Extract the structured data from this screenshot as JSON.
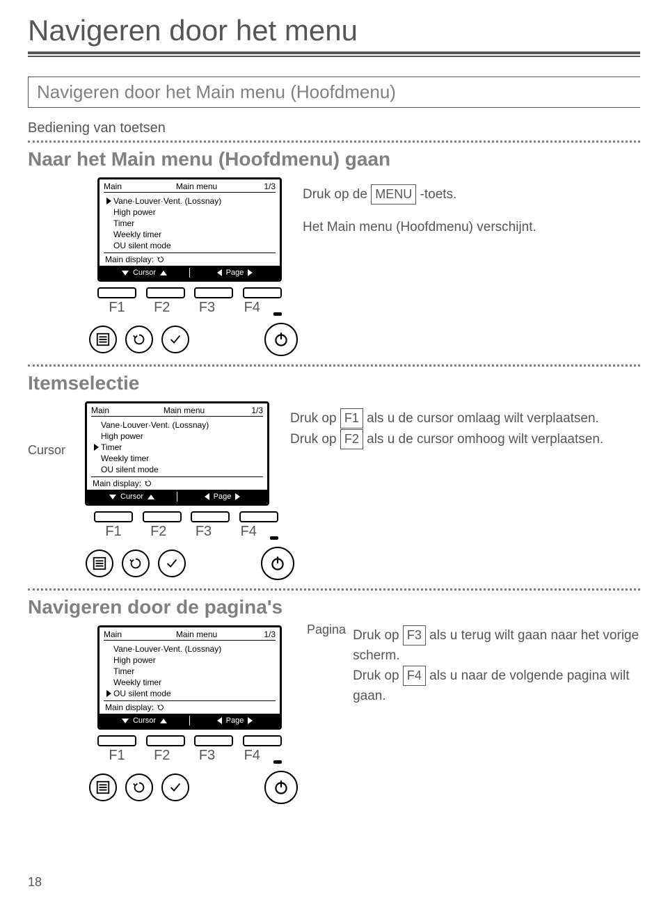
{
  "page": {
    "title": "Navigeren door het menu",
    "section_head": "Navigeren door het Main menu (Hoofdmenu)",
    "subhead": "Bediening van toetsen",
    "page_number": "18"
  },
  "s1": {
    "heading": "Naar het Main menu (Hoofdmenu) gaan",
    "instr_l1a": "Druk op de ",
    "instr_l1_btn": "MENU",
    "instr_l1b": " -toets.",
    "instr_l2": "Het Main menu (Hoofdmenu) verschijnt."
  },
  "s2": {
    "heading": "Itemselectie",
    "cursor_label": "Cursor",
    "instr_a1": "Druk op ",
    "instr_a_btn": "F1",
    "instr_a2": " als u de cursor omlaag wilt verplaatsen.",
    "instr_b1": "Druk op ",
    "instr_b_btn": "F2",
    "instr_b2": " als u de cursor omhoog wilt verplaatsen."
  },
  "s3": {
    "heading": "Navigeren door de pagina's",
    "pagina_label": "Pagina",
    "instr_a1": "Druk op ",
    "instr_a_btn": "F3",
    "instr_a2": " als u terug wilt gaan naar het vorige scherm.",
    "instr_b1": "Druk op ",
    "instr_b_btn": "F4",
    "instr_b2": " als u naar de volgende pagina wilt gaan."
  },
  "lcd": {
    "header_left": "Main",
    "header_center": "Main menu",
    "header_right": "1/3",
    "items": [
      "Vane·Louver·Vent. (Lossnay)",
      "High power",
      "Timer",
      "Weekly timer",
      "OU silent mode"
    ],
    "foot_label": "Main display:",
    "cursor_label": "Cursor",
    "page_label": "Page"
  },
  "fkeys": {
    "f1": "F1",
    "f2": "F2",
    "f3": "F3",
    "f4": "F4"
  },
  "icons": {
    "menu": "menu-icon",
    "undo": "undo-icon",
    "check": "check-icon",
    "power": "power-icon"
  }
}
